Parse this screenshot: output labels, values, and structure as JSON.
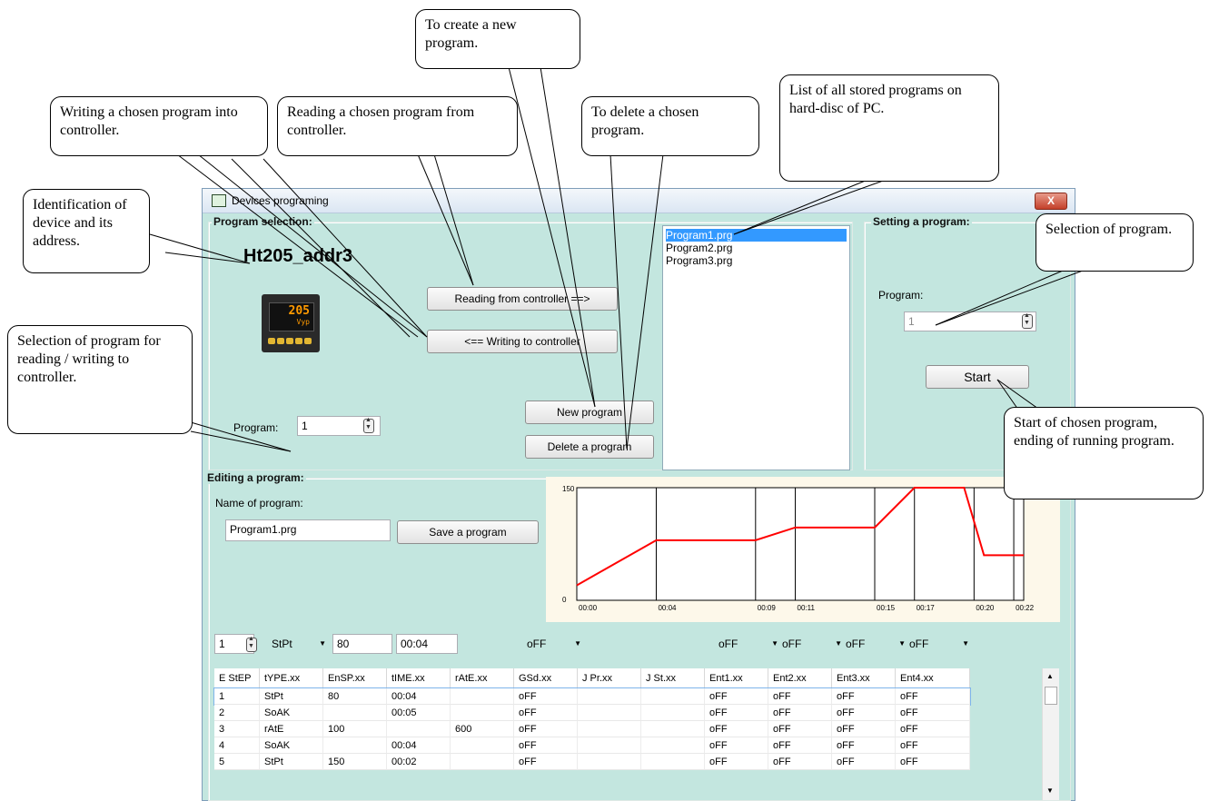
{
  "window": {
    "title": "Devices programing",
    "close_label": "X"
  },
  "program_selection": {
    "label": "Program selection:",
    "device_name": "Ht205_addr3",
    "device_display": {
      "value": "205",
      "sub": "Vyp"
    },
    "read_button": "Reading from controller ==>",
    "write_button": "<== Writing to controller",
    "new_button": "New program",
    "delete_button": "Delete a program",
    "program_label": "Program:",
    "program_value": "1",
    "programs": [
      "Program1.prg",
      "Program2.prg",
      "Program3.prg"
    ],
    "selected_program_index": 0
  },
  "setting_program": {
    "label": "Setting a program:",
    "program_label": "Program:",
    "program_value": "1",
    "start_button": "Start"
  },
  "editing": {
    "label": "Editing a program:",
    "name_label": "Name of program:",
    "name_value": "Program1.prg",
    "save_button": "Save a program",
    "step_value": "1",
    "type_value": "StPt",
    "ensp_value": "80",
    "time_value": "00:04",
    "gsd_value": "oFF",
    "ent_values": [
      "oFF",
      "oFF",
      "oFF",
      "oFF"
    ]
  },
  "table": {
    "headers": [
      "E StEP",
      "tYPE.xx",
      "EnSP.xx",
      "tIME.xx",
      "rAtE.xx",
      "GSd.xx",
      "J Pr.xx",
      "J St.xx",
      "Ent1.xx",
      "Ent2.xx",
      "Ent3.xx",
      "Ent4.xx"
    ],
    "rows": [
      [
        "1",
        "StPt",
        "80",
        "00:04",
        "",
        "oFF",
        "",
        "",
        "oFF",
        "oFF",
        "oFF",
        "oFF"
      ],
      [
        "2",
        "SoAK",
        "",
        "00:05",
        "",
        "oFF",
        "",
        "",
        "oFF",
        "oFF",
        "oFF",
        "oFF"
      ],
      [
        "3",
        "rAtE",
        "100",
        "",
        "600",
        "oFF",
        "",
        "",
        "oFF",
        "oFF",
        "oFF",
        "oFF"
      ],
      [
        "4",
        "SoAK",
        "",
        "00:04",
        "",
        "oFF",
        "",
        "",
        "oFF",
        "oFF",
        "oFF",
        "oFF"
      ],
      [
        "5",
        "StPt",
        "150",
        "00:02",
        "",
        "oFF",
        "",
        "",
        "oFF",
        "oFF",
        "oFF",
        "oFF"
      ]
    ]
  },
  "chart_data": {
    "type": "line",
    "ylim": [
      0,
      150
    ],
    "y_tick_labels": [
      "150",
      "0"
    ],
    "x_tick_labels": [
      "00:00",
      "00:04",
      "00:09",
      "00:11",
      "00:15",
      "00:17",
      "00:20",
      "00:22"
    ],
    "x_tick_minutes": [
      0,
      4,
      9,
      11,
      15,
      17,
      20,
      22
    ],
    "xlim_minutes": [
      0,
      22.5
    ],
    "series": [
      {
        "color": "#ff0000",
        "x_minutes": [
          0,
          4,
          9,
          11,
          15,
          17,
          19.5,
          20.5,
          22.5
        ],
        "y": [
          20,
          80,
          80,
          97,
          97,
          150,
          150,
          60,
          60
        ]
      }
    ]
  },
  "callouts": {
    "identification": "Identification of device and its address.",
    "writing": "Writing a chosen program into controller.",
    "reading": "Reading a chosen program from controller.",
    "create": "To create a new program.",
    "delete": "To delete a chosen program.",
    "list": "List of all stored programs on hard-disc of PC.",
    "selection": "Selection of program.",
    "selection_rw": "Selection of program for reading / writing to controller.",
    "start": "Start of chosen program, ending of running program."
  }
}
